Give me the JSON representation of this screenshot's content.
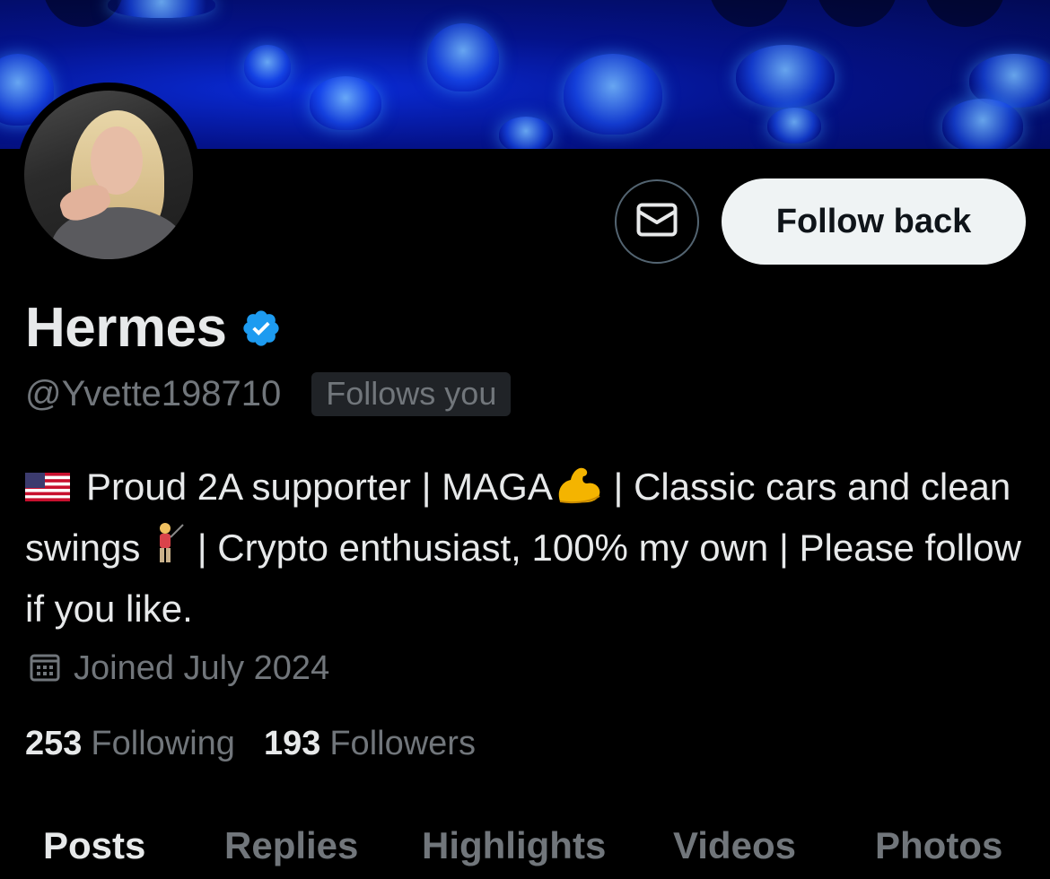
{
  "profile": {
    "name": "Hermes",
    "handle": "@Yvette198710",
    "follows_you_badge": "Follows you",
    "bio_part1": "Proud 2A supporter | MAGA",
    "bio_part2": " | Classic cars and clean swings ",
    "bio_part3": " | Crypto enthusiast, 100% my own | Please follow if you like.",
    "joined": "Joined July 2024",
    "following_count": "253",
    "following_label": "Following",
    "followers_count": "193",
    "followers_label": "Followers"
  },
  "actions": {
    "follow_back_label": "Follow back"
  },
  "tabs": [
    {
      "label": "Posts",
      "active": true
    },
    {
      "label": "Replies",
      "active": false
    },
    {
      "label": "Highlights",
      "active": false
    },
    {
      "label": "Videos",
      "active": false
    },
    {
      "label": "Photos",
      "active": false
    }
  ],
  "colors": {
    "background": "#000000",
    "primary_text": "#e7e9ea",
    "secondary_text": "#71767b",
    "verified_blue": "#1d9bf0",
    "button_bg": "#eff3f4"
  },
  "icons": [
    "message-icon",
    "verified-badge-icon",
    "us-flag-icon",
    "flexed-biceps-icon",
    "golfer-icon",
    "calendar-icon"
  ]
}
